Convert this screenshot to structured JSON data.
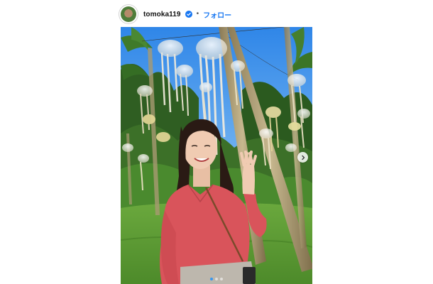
{
  "post": {
    "username": "tomoka119",
    "separator": "•",
    "follow_label": "フォロー",
    "verified_icon": "verified-badge-icon",
    "next_icon": "chevron-right-icon",
    "carousel_total": 3,
    "carousel_active_index": 0
  },
  "colors": {
    "follow": "#1877f2",
    "verified": "#1877f2",
    "active_dot": "#3897f0"
  }
}
